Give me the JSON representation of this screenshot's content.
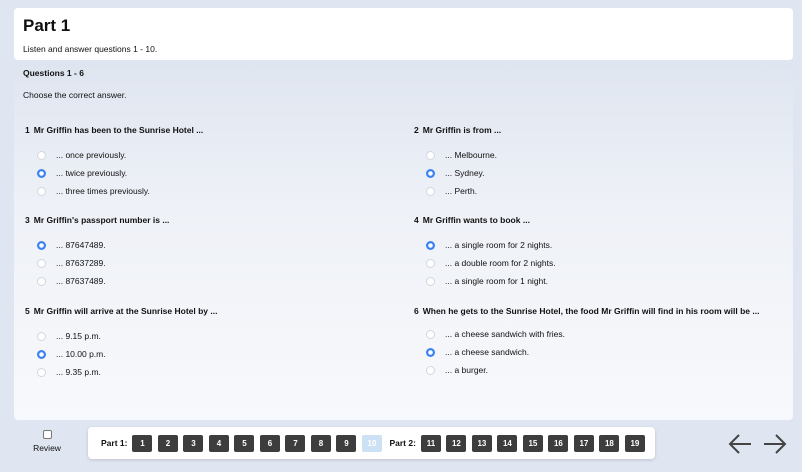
{
  "part": {
    "title": "Part 1",
    "instructions": "Listen and answer questions 1 - 10."
  },
  "section": {
    "range": "Questions 1 - 6",
    "instructions": "Choose the correct answer."
  },
  "questions": [
    {
      "number": "1",
      "text": "Mr Griffin has been to the Sunrise Hotel ...",
      "options": [
        "... once previously.",
        "... twice previously.",
        "... three times previously."
      ],
      "selected": 1
    },
    {
      "number": "2",
      "text": "Mr Griffin is from ...",
      "options": [
        "... Melbourne.",
        "... Sydney.",
        "... Perth."
      ],
      "selected": 1
    },
    {
      "number": "3",
      "text": "Mr Griffin's passport number is ...",
      "options": [
        "... 87647489.",
        "... 87637289.",
        "... 87637489."
      ],
      "selected": 0
    },
    {
      "number": "4",
      "text": "Mr Griffin wants to book ...",
      "options": [
        "... a single room for 2 nights.",
        "... a double room for 2 nights.",
        "... a single room for 1 night."
      ],
      "selected": 0
    },
    {
      "number": "5",
      "text": "Mr Griffin will arrive at the Sunrise Hotel by ...",
      "options": [
        "... 9.15 p.m.",
        "... 10.00 p.m.",
        "... 9.35 p.m."
      ],
      "selected": 1
    },
    {
      "number": "6",
      "text": "When he gets to the Sunrise Hotel, the food Mr Griffin will find in his room will be ...",
      "options": [
        "... a cheese sandwich with fries.",
        "... a cheese sandwich.",
        "... a burger."
      ],
      "selected": 1
    }
  ],
  "footer": {
    "review_label": "Review",
    "part1_label": "Part 1:",
    "part2_label": "Part 2:",
    "part1_buttons": [
      "1",
      "2",
      "3",
      "4",
      "5",
      "6",
      "7",
      "8",
      "9",
      "10"
    ],
    "part2_buttons": [
      "11",
      "12",
      "13",
      "14",
      "15",
      "16",
      "17",
      "18",
      "19"
    ],
    "current": "10"
  },
  "colors": {
    "accent": "#3b82f6",
    "nav_button": "#3d3d3d",
    "current_button": "#cde1f5",
    "background": "#dfe5f1"
  },
  "icons": {
    "prev": "arrow-left-icon",
    "next": "arrow-right-icon"
  }
}
